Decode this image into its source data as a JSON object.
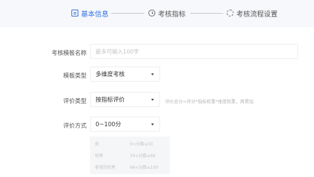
{
  "steps": [
    {
      "label": "基本信息",
      "active": true
    },
    {
      "label": "考核指标",
      "active": false
    },
    {
      "label": "考核流程设置",
      "active": false
    }
  ],
  "form": {
    "template_name": {
      "label": "考核模板名称",
      "value": "",
      "placeholder": "最多可输入100字"
    },
    "template_type": {
      "label": "模板类型",
      "value": "多维度考核"
    },
    "evaluation_type": {
      "label": "评价类型",
      "value": "按指标评价",
      "hint": "评价总分=评分*指标权重*维度权重，再累加"
    },
    "evaluation_method": {
      "label": "评价方式",
      "value": "0~100分"
    }
  },
  "grades": [
    {
      "name": "良",
      "range": "0<分数≤33"
    },
    {
      "name": "优秀",
      "range": "33<分数≤66"
    },
    {
      "name": "非常的优秀",
      "range": "66<分数≤100"
    }
  ],
  "colors": {
    "accent": "#2f6fe4",
    "step_bar": "#f7f8fb",
    "grade_bg": "#f5f6f8"
  }
}
